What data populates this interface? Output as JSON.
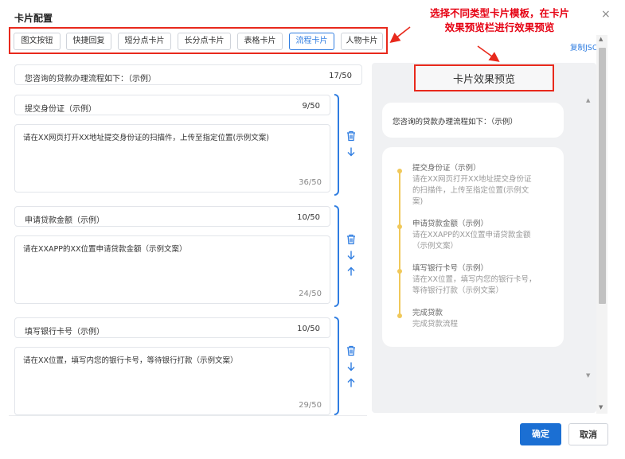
{
  "dialog": {
    "title": "卡片配置",
    "close": "×"
  },
  "annotation": {
    "text_line1": "选择不同类型卡片模板，在卡片",
    "text_line2": "效果预览栏进行效果预览"
  },
  "tabs": [
    {
      "label": "图文按钮"
    },
    {
      "label": "快捷回复"
    },
    {
      "label": "短分点卡片"
    },
    {
      "label": "长分点卡片"
    },
    {
      "label": "表格卡片"
    },
    {
      "label": "流程卡片",
      "active": true
    },
    {
      "label": "人物卡片"
    }
  ],
  "copy_json": "复制JSON",
  "header_field": {
    "value": "您咨询的贷款办理流程如下：（示例）",
    "count": "17/50"
  },
  "steps": [
    {
      "title": "提交身份证（示例）",
      "title_count": "9/50",
      "body": "请在XX网页打开XX地址提交身份证的扫描件，上传至指定位置(示例文案)",
      "body_count": "36/50"
    },
    {
      "title": "申请贷款金额（示例）",
      "title_count": "10/50",
      "body": "请在XXAPP的XX位置申请贷款金额（示例文案）",
      "body_count": "24/50"
    },
    {
      "title": "填写银行卡号（示例）",
      "title_count": "10/50",
      "body": "请在XX位置，填写内您的银行卡号，等待银行打款（示例文案）",
      "body_count": "29/50"
    }
  ],
  "preview": {
    "title": "卡片效果预览",
    "intro": "您咨询的贷款办理流程如下：（示例）",
    "timeline": [
      {
        "title": "提交身份证（示例）",
        "lines": [
          "请在XX网页打开XX地址提交身份证",
          "的扫描件，上传至指定位置(示例文",
          "案)"
        ]
      },
      {
        "title": "申请贷款金额（示例）",
        "lines": [
          "请在XXAPP的XX位置申请贷款金额",
          "（示例文案）"
        ]
      },
      {
        "title": "填写银行卡号（示例）",
        "lines": [
          "请在XX位置，填写内您的银行卡号，",
          "等待银行打款（示例文案）"
        ]
      },
      {
        "title": "完成贷款",
        "lines": [
          "完成贷款流程"
        ]
      }
    ]
  },
  "footer": {
    "confirm": "确定",
    "cancel": "取消"
  },
  "colors": {
    "accent": "#2f7de1",
    "annotation_red": "#e8291c",
    "primary_button": "#1b6fd3",
    "timeline_dot": "#f0c85a"
  }
}
